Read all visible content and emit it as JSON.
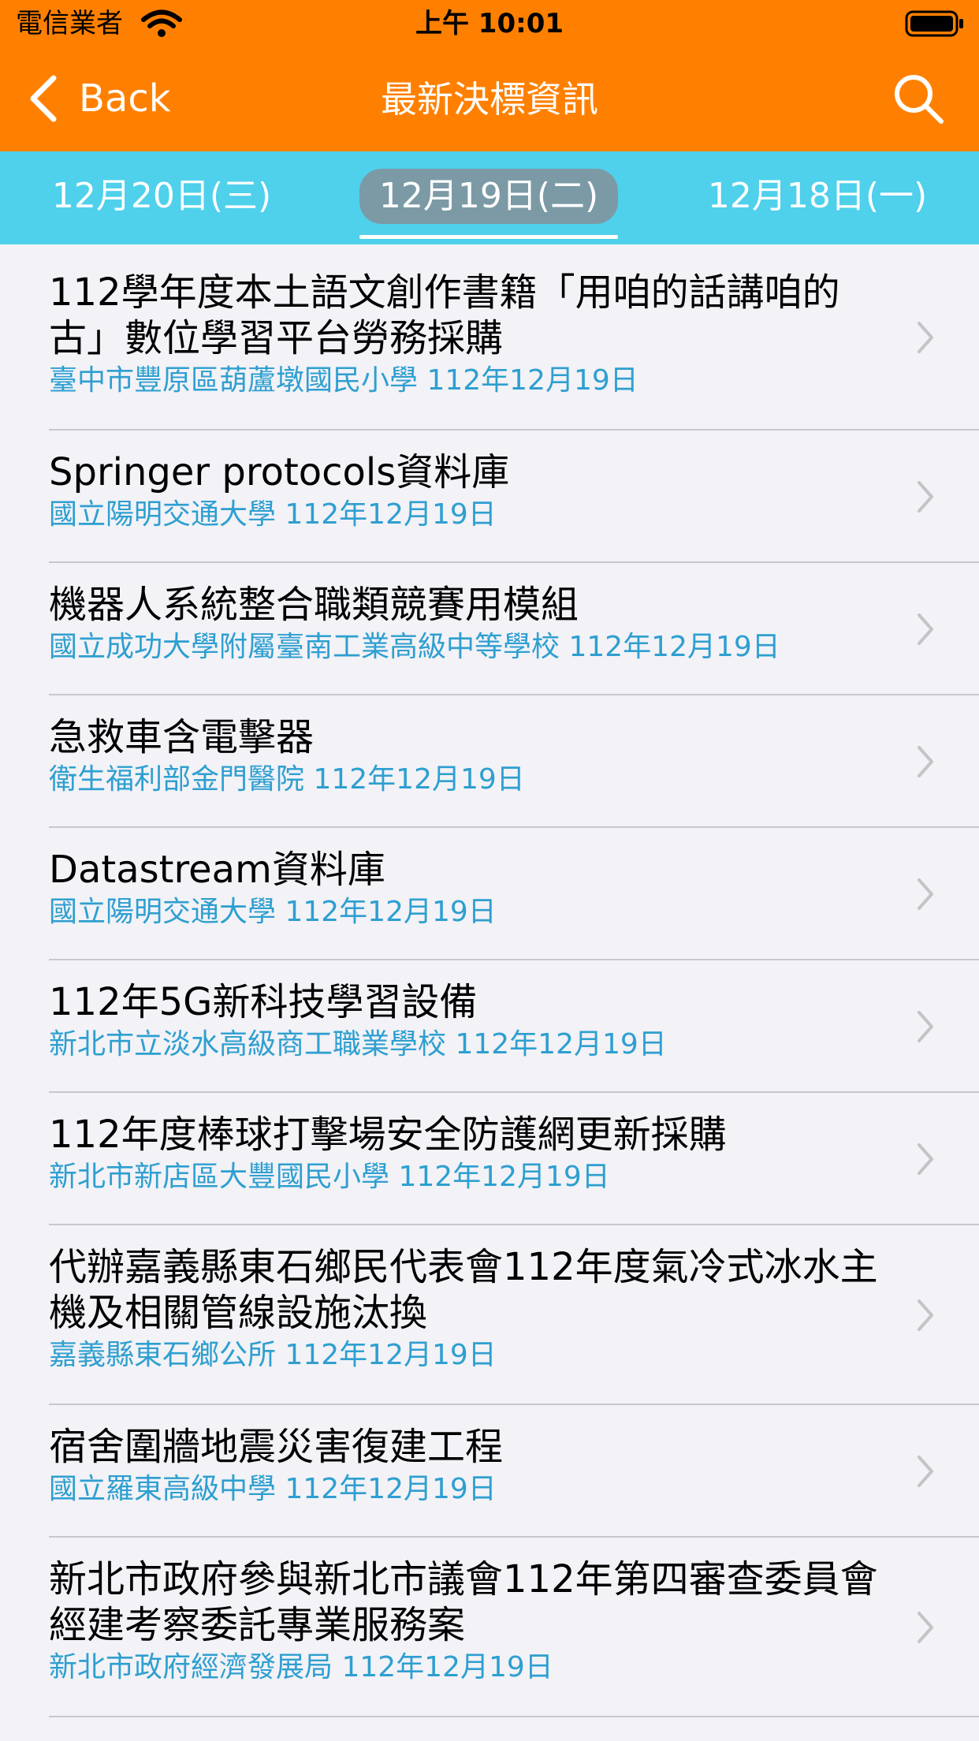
{
  "status_bar": {
    "carrier": "電信業者",
    "time": "上午 10:01"
  },
  "nav": {
    "back_label": "Back",
    "title": "最新決標資訊"
  },
  "date_tabs": [
    {
      "label": "12月20日(三)",
      "active": false
    },
    {
      "label": "12月19日(二)",
      "active": true
    },
    {
      "label": "12月18日(一)",
      "active": false
    }
  ],
  "items": [
    {
      "title": "112學年度本土語文創作書籍「用咱的話講咱的古」數位學習平台勞務採購",
      "agency": "臺中市豐原區葫蘆墩國民小學",
      "date": "112年12月19日"
    },
    {
      "title": "Springer protocols資料庫",
      "agency": "國立陽明交通大學",
      "date": "112年12月19日"
    },
    {
      "title": "機器人系統整合職類競賽用模組",
      "agency": "國立成功大學附屬臺南工業高級中等學校",
      "date": "112年12月19日"
    },
    {
      "title": "急救車含電擊器",
      "agency": "衛生福利部金門醫院",
      "date": "112年12月19日"
    },
    {
      "title": "Datastream資料庫",
      "agency": "國立陽明交通大學",
      "date": "112年12月19日"
    },
    {
      "title": "112年5G新科技學習設備",
      "agency": "新北市立淡水高級商工職業學校",
      "date": "112年12月19日"
    },
    {
      "title": "112年度棒球打擊場安全防護網更新採購",
      "agency": "新北市新店區大豐國民小學",
      "date": "112年12月19日"
    },
    {
      "title": "代辦嘉義縣東石鄉民代表會112年度氣冷式冰水主機及相關管線設施汰換",
      "agency": "嘉義縣東石鄉公所",
      "date": "112年12月19日"
    },
    {
      "title": "宿舍圍牆地震災害復建工程",
      "agency": "國立羅東高級中學",
      "date": "112年12月19日"
    },
    {
      "title": "新北市政府參與新北市議會112年第四審查委員會經建考察委託專業服務案",
      "agency": "新北市政府經濟發展局",
      "date": "112年12月19日"
    }
  ],
  "colors": {
    "header_orange": "#ff8000",
    "tabs_cyan": "#4fd0eb",
    "active_tab_grey": "#7b9aa6",
    "subtitle_blue": "#2e9fd0"
  }
}
